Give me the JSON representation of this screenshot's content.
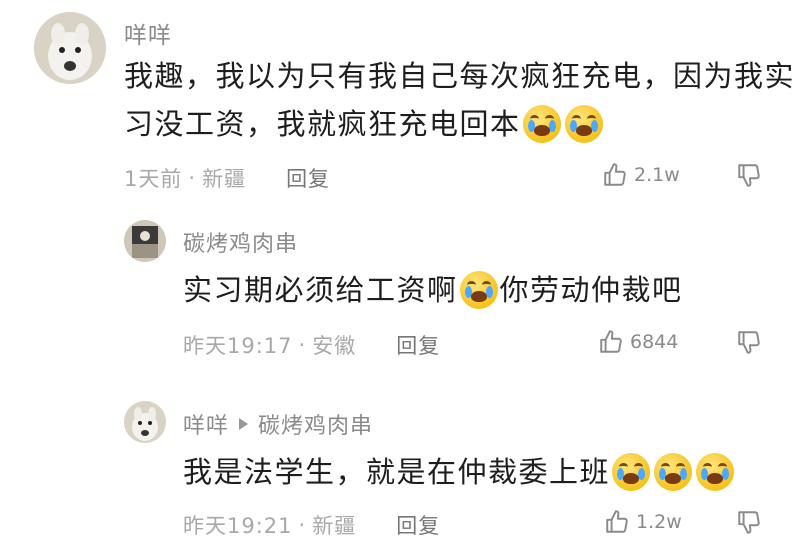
{
  "comments": [
    {
      "username": "咩咩",
      "text": "我趣，我以为只有我自己每次疯狂充电，因为我实习没工资，我就疯狂充电回本",
      "line1": "我趣，我以为只有我自己每次疯狂充电，因为我实",
      "line2": "习没工资，我就疯狂充电回本",
      "time": "1天前",
      "location": "新疆",
      "reply_label": "回复",
      "likes": "2.1w"
    },
    {
      "username": "碳烤鸡肉串",
      "text_a": "实习期必须给工资啊",
      "text_b": "你劳动仲裁吧",
      "time": "昨天19:17",
      "location": "安徽",
      "reply_label": "回复",
      "likes": "6844"
    },
    {
      "username": "咩咩",
      "reply_to": "碳烤鸡肉串",
      "text": "我是法学生，就是在仲裁委上班",
      "time": "昨天19:21",
      "location": "新疆",
      "reply_label": "回复",
      "likes": "1.2w"
    }
  ],
  "separator": "·",
  "icons": {
    "like": "thumbs-up-icon",
    "dislike": "thumbs-down-icon",
    "emoji": "crying-emoji-icon",
    "reply_arrow": "triangle-right-icon"
  }
}
